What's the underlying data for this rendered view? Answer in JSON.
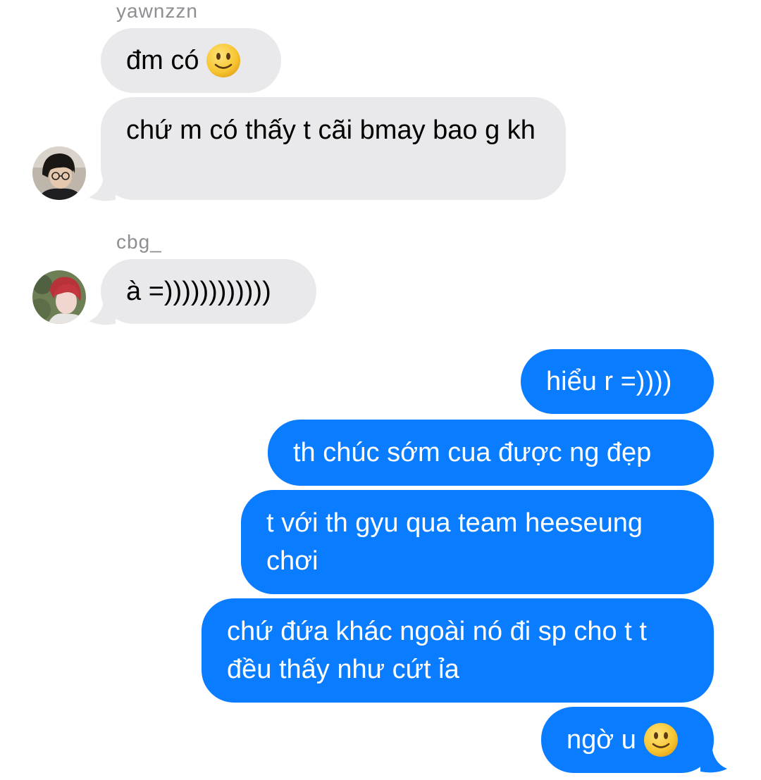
{
  "conversation": {
    "groups": [
      {
        "sender": "yawnzzn",
        "messages": [
          {
            "text": "đm có",
            "emoji": "slightly-smiling-face"
          },
          {
            "text": "chứ m có thấy t cãi bmay bao g kh"
          }
        ]
      },
      {
        "sender": "cbg_",
        "messages": [
          {
            "text": "à =))))))))))))"
          }
        ]
      }
    ],
    "outgoing": [
      {
        "text": "hiểu r =))))"
      },
      {
        "text": "th chúc sớm cua được ng đẹp"
      },
      {
        "text": "t với th gyu qua team heeseung chơi"
      },
      {
        "text": "chứ đứa khác ngoài nó đi sp cho t t đều thấy như cứt ỉa"
      },
      {
        "text": "ngờ u",
        "emoji": "slightly-smiling-face"
      }
    ]
  },
  "colors": {
    "incoming_bubble": "#e9e9eb",
    "outgoing_bubble": "#0a7cff",
    "sender_name": "#8e8e93",
    "emoji_face": "#f7c531"
  },
  "icons": {
    "avatar_1": "avatar-person-glasses",
    "avatar_2": "avatar-person-red-hair"
  }
}
